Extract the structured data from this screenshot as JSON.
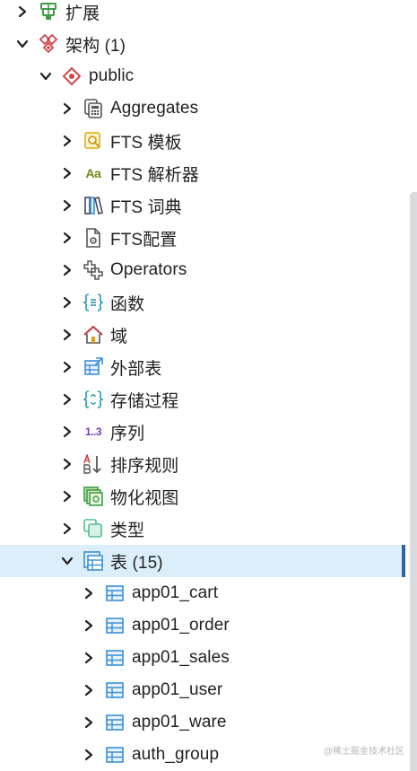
{
  "tree": {
    "rows": [
      {
        "label": "扩展",
        "icon": "extension-icon",
        "expanded": false
      },
      {
        "label": "架构 (1)",
        "icon": "schemas-icon",
        "expanded": true
      },
      {
        "label": "public",
        "icon": "schema-icon",
        "expanded": true
      },
      {
        "label": "Aggregates",
        "icon": "aggregate-icon",
        "expanded": false
      },
      {
        "label": "FTS 模板",
        "icon": "fts-template-icon",
        "expanded": false
      },
      {
        "label": "FTS 解析器",
        "icon": "fts-parser-icon",
        "expanded": false,
        "icon_text": "Aa"
      },
      {
        "label": "FTS 词典",
        "icon": "fts-dictionary-icon",
        "expanded": false
      },
      {
        "label": "FTS配置",
        "icon": "fts-configuration-icon",
        "expanded": false
      },
      {
        "label": "Operators",
        "icon": "operator-icon",
        "expanded": false
      },
      {
        "label": "函数",
        "icon": "function-icon",
        "expanded": false
      },
      {
        "label": "域",
        "icon": "domain-icon",
        "expanded": false
      },
      {
        "label": "外部表",
        "icon": "foreign-table-icon",
        "expanded": false
      },
      {
        "label": "存储过程",
        "icon": "procedure-icon",
        "expanded": false
      },
      {
        "label": "序列",
        "icon": "sequence-icon",
        "expanded": false,
        "icon_text": "1..3"
      },
      {
        "label": "排序规则",
        "icon": "collation-icon",
        "expanded": false
      },
      {
        "label": "物化视图",
        "icon": "materialized-view-icon",
        "expanded": false
      },
      {
        "label": "类型",
        "icon": "type-icon",
        "expanded": false
      },
      {
        "label": "表 (15)",
        "icon": "tables-icon",
        "expanded": true,
        "selected": true
      },
      {
        "label": "app01_cart",
        "icon": "table-icon",
        "expanded": false
      },
      {
        "label": "app01_order",
        "icon": "table-icon",
        "expanded": false
      },
      {
        "label": "app01_sales",
        "icon": "table-icon",
        "expanded": false
      },
      {
        "label": "app01_user",
        "icon": "table-icon",
        "expanded": false
      },
      {
        "label": "app01_ware",
        "icon": "table-icon",
        "expanded": false
      },
      {
        "label": "auth_group",
        "icon": "table-icon",
        "expanded": false
      }
    ]
  },
  "watermark": "@稀土掘金技术社区",
  "colors": {
    "selected_bg": "#dbeefa",
    "selected_accent": "#326690",
    "table_icon": "#3c8fd4",
    "schema_icon": "#d0444a",
    "extension_icon": "#3f9b49"
  }
}
